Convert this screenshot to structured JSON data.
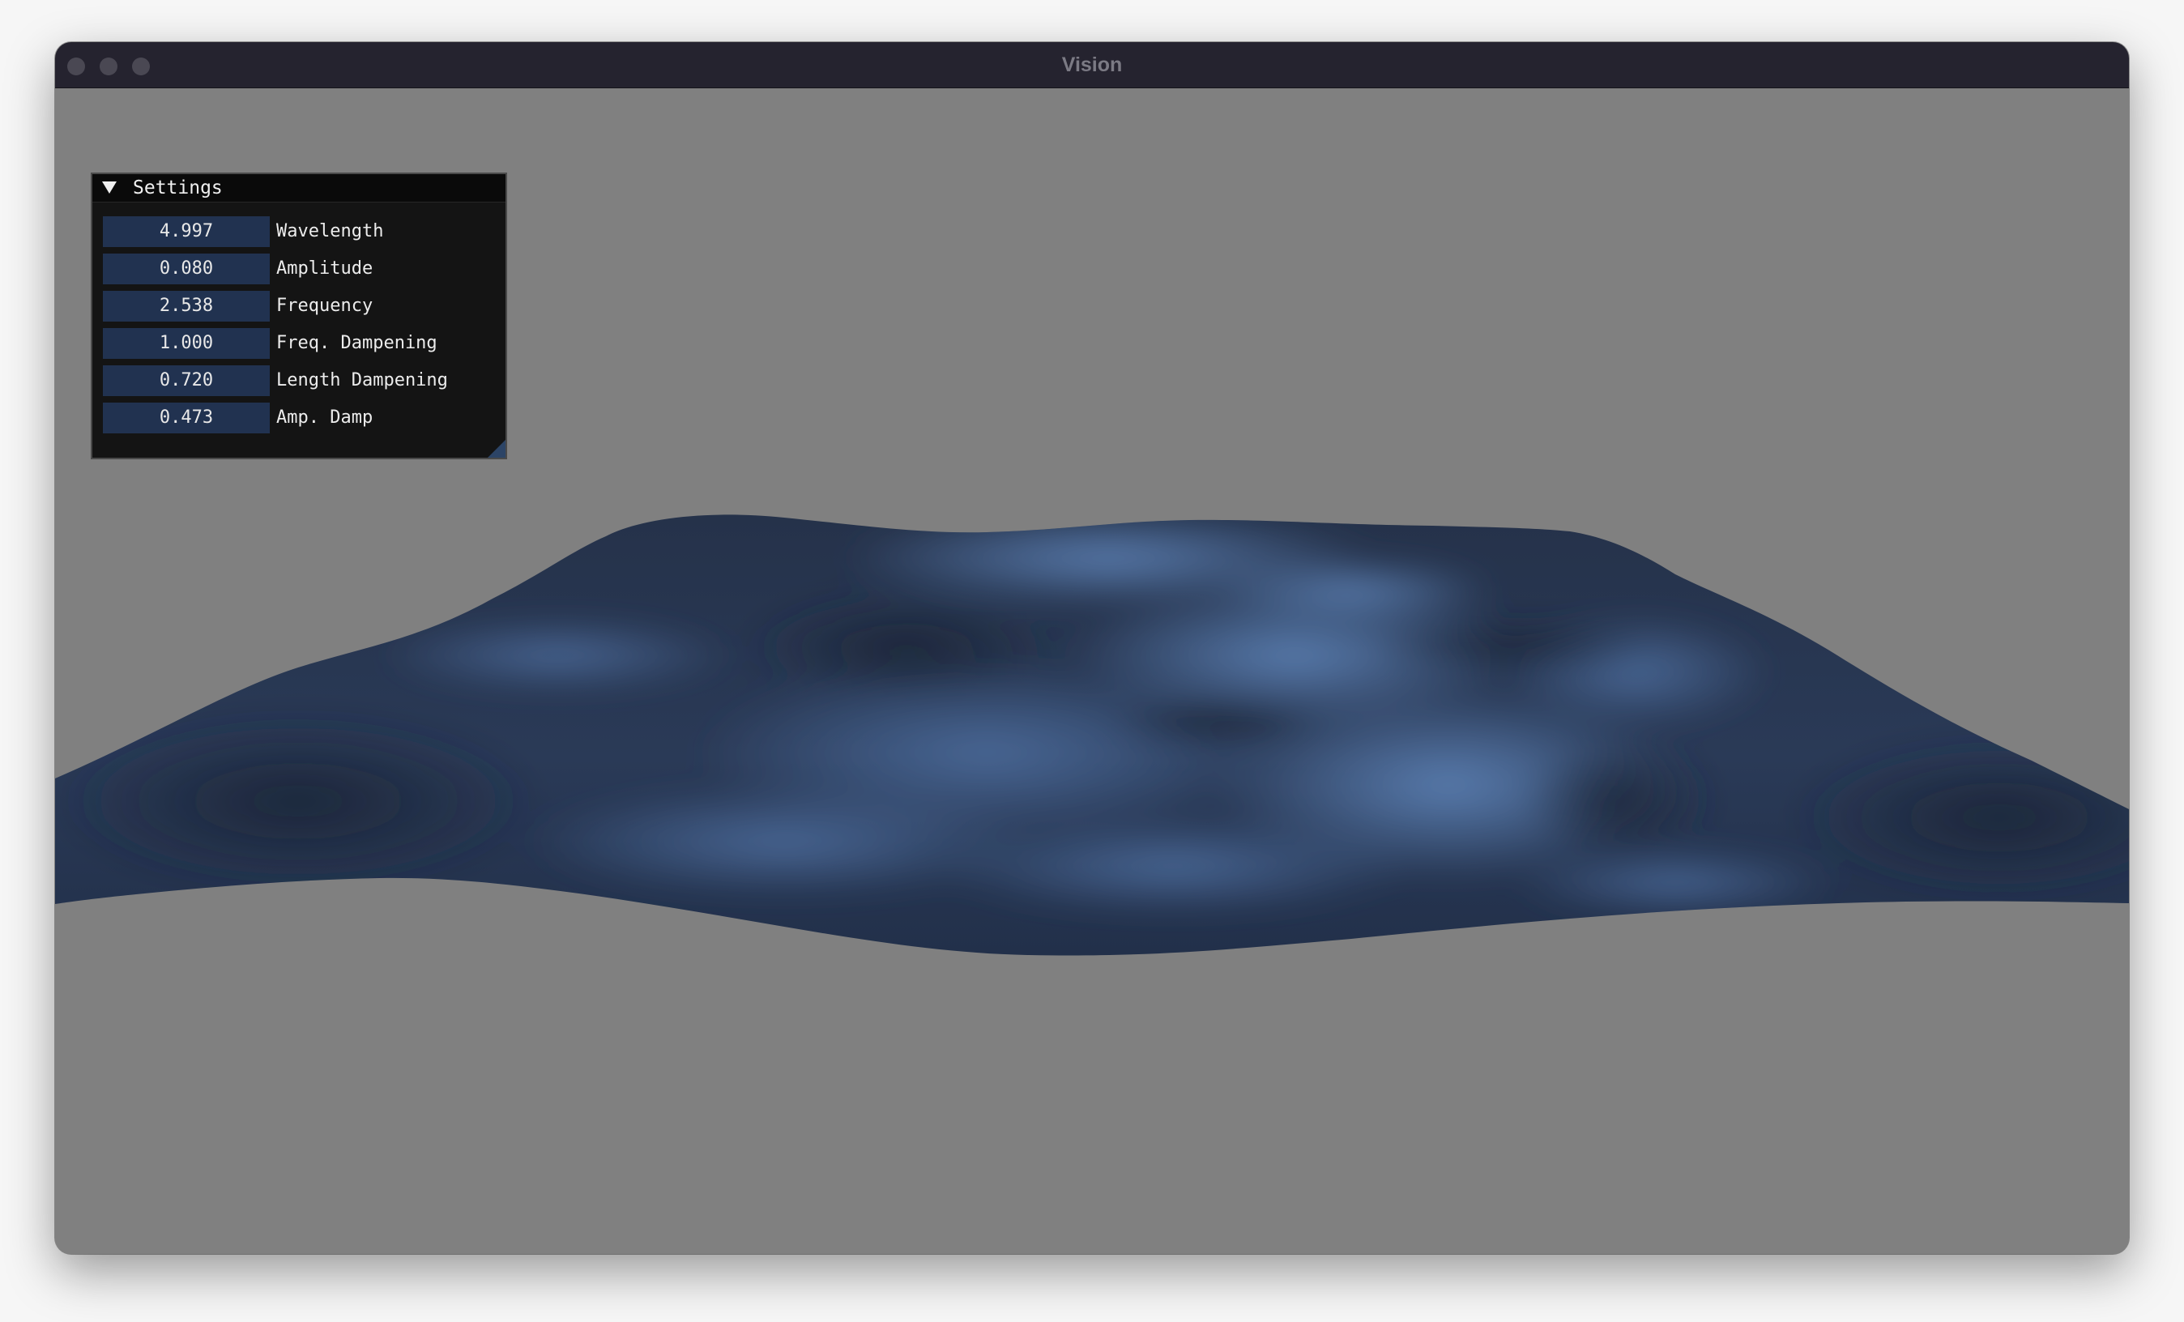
{
  "window": {
    "title": "Vision",
    "controls": [
      "close-button",
      "minimize-button",
      "zoom-button"
    ]
  },
  "settings_panel": {
    "title": "Settings",
    "collapse_icon": "triangle-down-icon",
    "rows": [
      {
        "value": "4.997",
        "label": "Wavelength"
      },
      {
        "value": "0.080",
        "label": "Amplitude"
      },
      {
        "value": "2.538",
        "label": "Frequency"
      },
      {
        "value": "1.000",
        "label": "Freq. Dampening"
      },
      {
        "value": "0.720",
        "label": "Length Dampening"
      },
      {
        "value": "0.473",
        "label": "Amp. Damp"
      }
    ]
  },
  "scene": {
    "background_color": "#808080",
    "surface_color_dark": "#202c3f",
    "surface_color_light": "#5577a6"
  }
}
